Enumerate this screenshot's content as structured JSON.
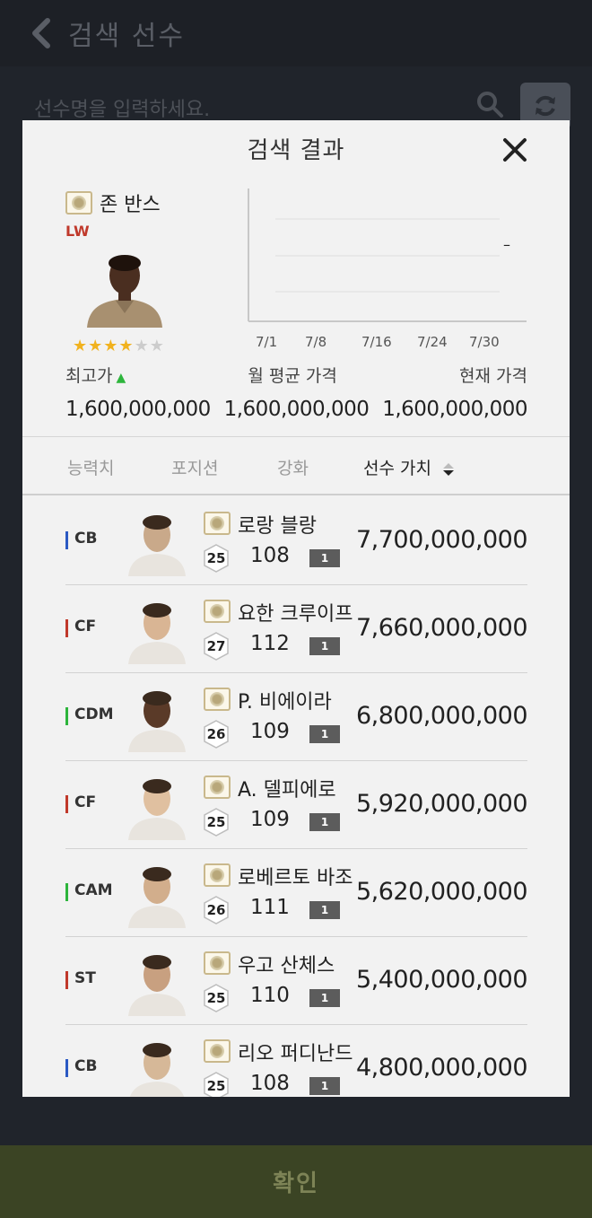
{
  "topbar": {
    "title": "검색 선수"
  },
  "search": {
    "placeholder": "선수명을 입력하세요."
  },
  "confirm": {
    "label": "확인"
  },
  "modal": {
    "title": "검색 결과",
    "player": {
      "name": "존 반스",
      "position": "LW",
      "stars_filled": 4,
      "stars_total": 6
    },
    "chart": {
      "x_labels": [
        "7/1",
        "7/8",
        "7/16",
        "7/24",
        "7/30"
      ],
      "right_mark": "–"
    },
    "prices": {
      "max_label": "최고가",
      "max_value": "1,600,000,000",
      "avg_label": "월 평균 가격",
      "avg_value": "1,600,000,000",
      "current_label": "현재 가격",
      "current_value": "1,600,000,000"
    },
    "tabs": [
      {
        "label": "능력치"
      },
      {
        "label": "포지션"
      },
      {
        "label": "강화"
      },
      {
        "label": "선수 가치"
      }
    ],
    "rows": [
      {
        "pos": "CB",
        "pos_color": "#2b59c3",
        "name": "로랑 블랑",
        "level": "25",
        "ovr": "108",
        "enh": "1",
        "price": "7,700,000,000"
      },
      {
        "pos": "CF",
        "pos_color": "#c0392b",
        "name": "요한 크루이프",
        "level": "27",
        "ovr": "112",
        "enh": "1",
        "price": "7,660,000,000"
      },
      {
        "pos": "CDM",
        "pos_color": "#2db53c",
        "name": "P. 비에이라",
        "level": "26",
        "ovr": "109",
        "enh": "1",
        "price": "6,800,000,000"
      },
      {
        "pos": "CF",
        "pos_color": "#c0392b",
        "name": "A. 델피에로",
        "level": "25",
        "ovr": "109",
        "enh": "1",
        "price": "5,920,000,000"
      },
      {
        "pos": "CAM",
        "pos_color": "#2db53c",
        "name": "로베르토 바조",
        "level": "26",
        "ovr": "111",
        "enh": "1",
        "price": "5,620,000,000"
      },
      {
        "pos": "ST",
        "pos_color": "#c0392b",
        "name": "우고 산체스",
        "level": "25",
        "ovr": "110",
        "enh": "1",
        "price": "5,400,000,000"
      },
      {
        "pos": "CB",
        "pos_color": "#2b59c3",
        "name": "리오 퍼디난드",
        "level": "25",
        "ovr": "108",
        "enh": "1",
        "price": "4,800,000,000"
      }
    ]
  }
}
